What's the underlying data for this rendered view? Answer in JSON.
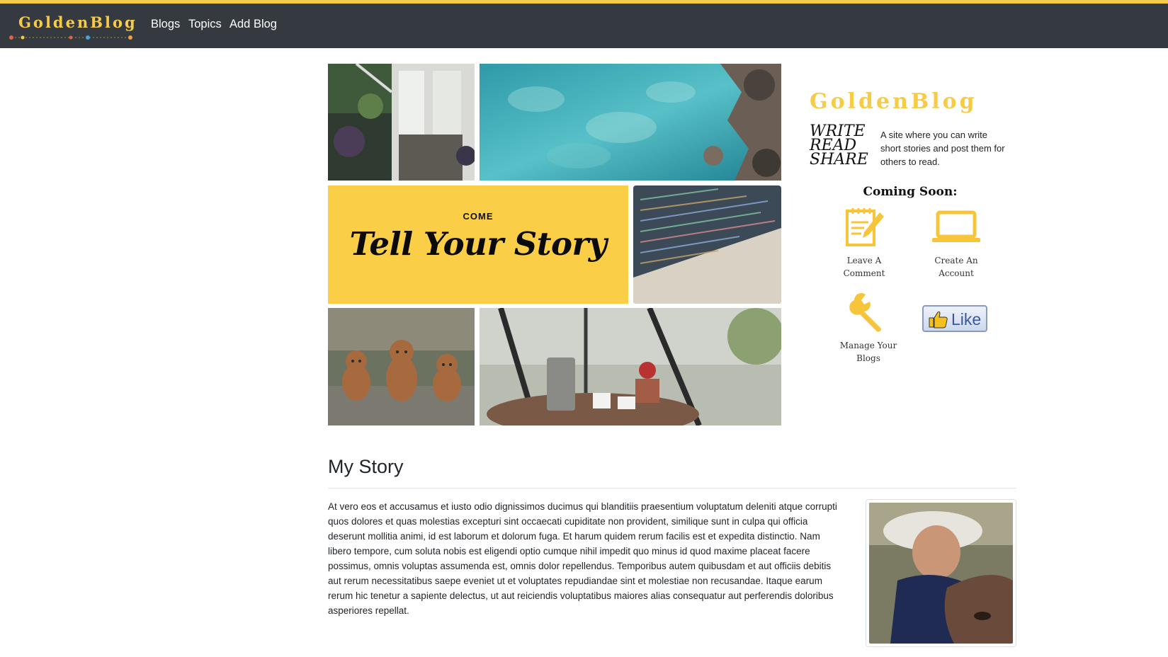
{
  "navbar": {
    "brand": "GoldenBlog",
    "links": [
      "Blogs",
      "Topics",
      "Add Blog"
    ]
  },
  "hero": {
    "kicker": "COME",
    "headline": "Tell Your Story"
  },
  "sidebar": {
    "brand": "GoldenBlog",
    "tagline_words": [
      "WRITE",
      "READ",
      "SHARE"
    ],
    "description": "A site where you can write short stories and post them for others to read.",
    "coming_soon_title": "Coming Soon:",
    "features": [
      {
        "label": "Leave A Comment",
        "icon": "notepad-pencil-icon"
      },
      {
        "label": "Create An Account",
        "icon": "laptop-icon"
      },
      {
        "label": "Manage Your Blogs",
        "icon": "wrench-icon"
      }
    ],
    "like_label": "Like"
  },
  "story": {
    "title": "My Story",
    "body": "At vero eos et accusamus et iusto odio dignissimos ducimus qui blanditiis praesentium voluptatum deleniti atque corrupti quos dolores et quas molestias excepturi sint occaecati cupiditate non provident, similique sunt in culpa qui officia deserunt mollitia animi, id est laborum et dolorum fuga. Et harum quidem rerum facilis est et expedita distinctio. Nam libero tempore, cum soluta nobis est eligendi optio cumque nihil impedit quo minus id quod maxime placeat facere possimus, omnis voluptas assumenda est, omnis dolor repellendus. Temporibus autem quibusdam et aut officiis debitis aut rerum necessitatibus saepe eveniet ut et voluptates repudiandae sint et molestiae non recusandae. Itaque earum rerum hic tenetur a sapiente delectus, ut aut reiciendis voluptatibus maiores alias consequatur aut perferendis doloribus asperiores repellat."
  },
  "colors": {
    "accent": "#f8cb46",
    "navbar_bg": "#343a40",
    "story_tile": "#fbce47",
    "link_blue": "#3b5998"
  }
}
